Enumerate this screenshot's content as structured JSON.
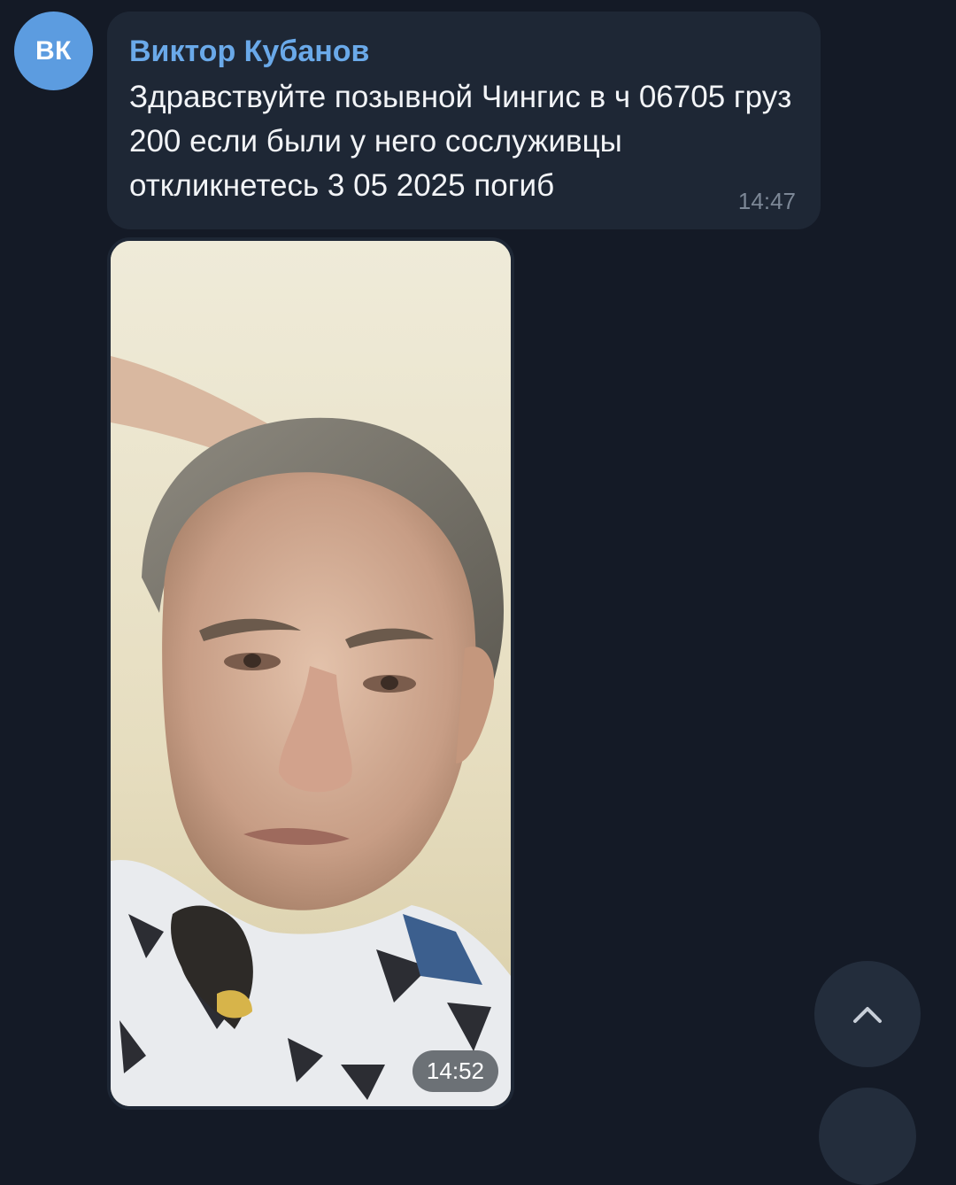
{
  "chat": {
    "avatar_initials": "ВК",
    "avatar_color": "#5c9ce0",
    "background_color": "#141a26"
  },
  "message": {
    "sender": "Виктор Кубанов",
    "sender_color": "#6aa9e9",
    "text": "Здравствуйте позывной Чингис в ч 06705 груз 200 если были у него сослуживцы откликнетесь 3 05 2025 погиб",
    "time": "14:47"
  },
  "photo_message": {
    "time": "14:52"
  },
  "controls": {
    "scroll_up_icon": "chevron-up-icon"
  }
}
